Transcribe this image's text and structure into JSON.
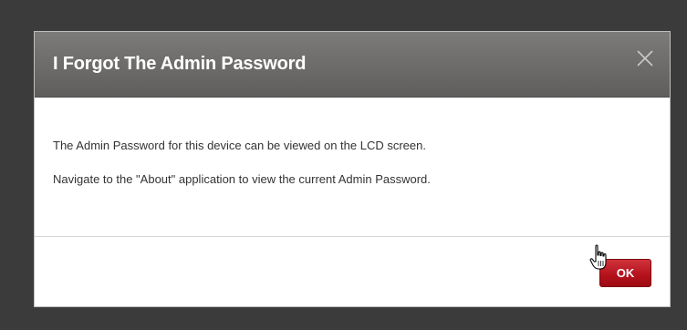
{
  "dialog": {
    "title": "I Forgot The Admin Password",
    "close_icon": "close-icon",
    "body": {
      "line1": "The Admin Password for this device can be viewed on the LCD screen.",
      "line2": "Navigate to the \"About\" application to view the current Admin Password."
    },
    "footer": {
      "ok_label": "OK"
    }
  },
  "colors": {
    "header": "#6c6b69",
    "overlay": "#3b3b3b",
    "ok_button": "#b3121b"
  },
  "cursor": {
    "icon": "hand-pointer-icon"
  }
}
